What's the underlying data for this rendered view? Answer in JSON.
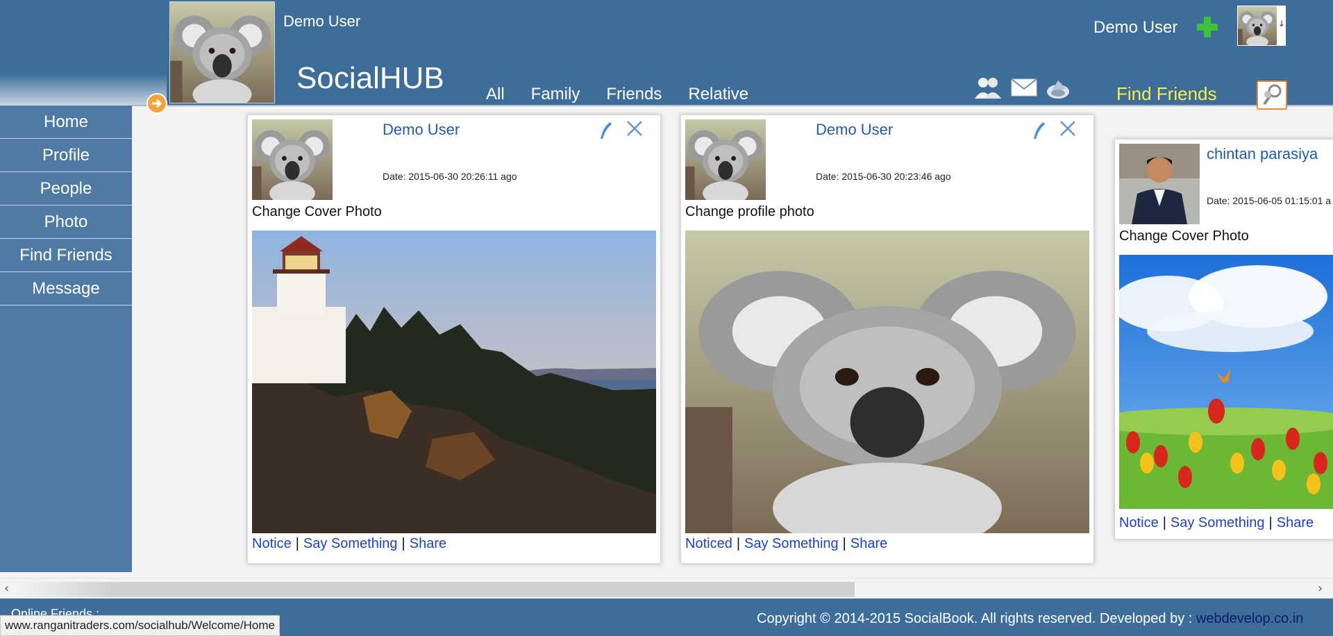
{
  "header": {
    "user_name": "Demo User",
    "brand": "SocialHUB",
    "tabs": [
      {
        "label": "All"
      },
      {
        "label": "Family"
      },
      {
        "label": "Friends"
      },
      {
        "label": "Relative"
      }
    ],
    "find_friends": "Find Friends",
    "top_right_name": "Demo User",
    "icons": [
      "friends-icon",
      "mail-icon",
      "notifications-icon"
    ]
  },
  "sidebar": {
    "items": [
      {
        "label": "Home"
      },
      {
        "label": "Profile"
      },
      {
        "label": "People"
      },
      {
        "label": "Photo"
      },
      {
        "label": "Find Friends"
      },
      {
        "label": "Message"
      }
    ]
  },
  "posts": [
    {
      "author": "Demo User",
      "date": "Date: 2015-06-30 20:26:11 ago",
      "caption": "Change Cover Photo",
      "photo": "lighthouse-coast-photo",
      "actions": {
        "notice": "Notice",
        "say": "Say Something",
        "share": "Share"
      }
    },
    {
      "author": "Demo User",
      "date": "Date: 2015-06-30 20:23:46 ago",
      "caption": "Change profile photo",
      "photo": "koala-photo",
      "actions": {
        "notice": "Noticed",
        "say": "Say Something",
        "share": "Share"
      }
    },
    {
      "author": "chintan parasiya",
      "date": "Date: 2015-06-05 01:15:01 a",
      "caption": "Change Cover Photo",
      "photo": "tulips-sky-photo",
      "actions": {
        "notice": "Notice",
        "say": "Say Something",
        "share": "Share"
      }
    }
  ],
  "action_separator": "|",
  "footer": {
    "online_label": "Online Friends :",
    "copyright": "Copyright © 2014-2015 SocialBook. All rights reserved. Developed by : ",
    "developer": "webdevelop.co.in"
  },
  "status_url": "www.ranganitraders.com/socialhub/Welcome/Home",
  "colors": {
    "header_bg": "#3e6d99",
    "sidebar_bg": "#4e7aa3",
    "link_blue": "#1d3ed1",
    "name_blue": "#1d5bb8",
    "find_friends_yellow": "#f7ef4a"
  }
}
